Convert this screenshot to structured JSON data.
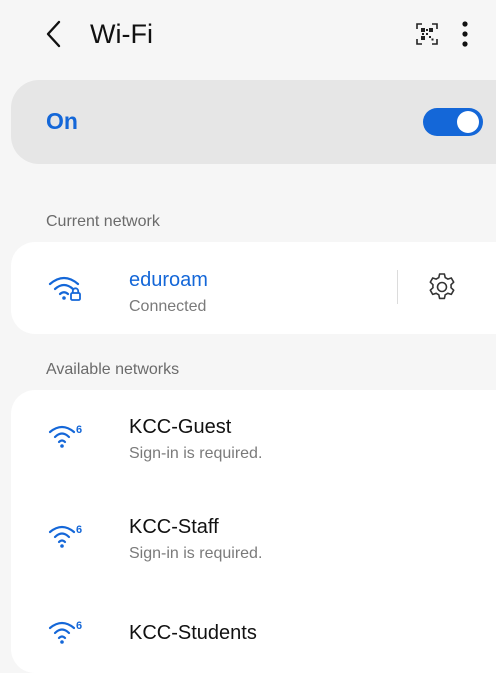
{
  "header": {
    "title": "Wi-Fi",
    "back_icon": "chevron-left-icon",
    "qr_icon": "qr-code-scanner-icon",
    "more_icon": "more-vertical-icon"
  },
  "master_toggle": {
    "label": "On",
    "state": true,
    "accent_color": "#1467d8"
  },
  "current_network": {
    "section_label": "Current network",
    "name": "eduroam",
    "status": "Connected",
    "icon": "wifi-lock-icon",
    "settings_icon": "gear-icon"
  },
  "available_networks": {
    "section_label": "Available networks",
    "items": [
      {
        "name": "KCC-Guest",
        "status": "Sign-in is required.",
        "icon": "wifi-6-icon"
      },
      {
        "name": "KCC-Staff",
        "status": "Sign-in is required.",
        "icon": "wifi-6-icon"
      },
      {
        "name": "KCC-Students",
        "status": "",
        "icon": "wifi-6-icon"
      }
    ]
  }
}
